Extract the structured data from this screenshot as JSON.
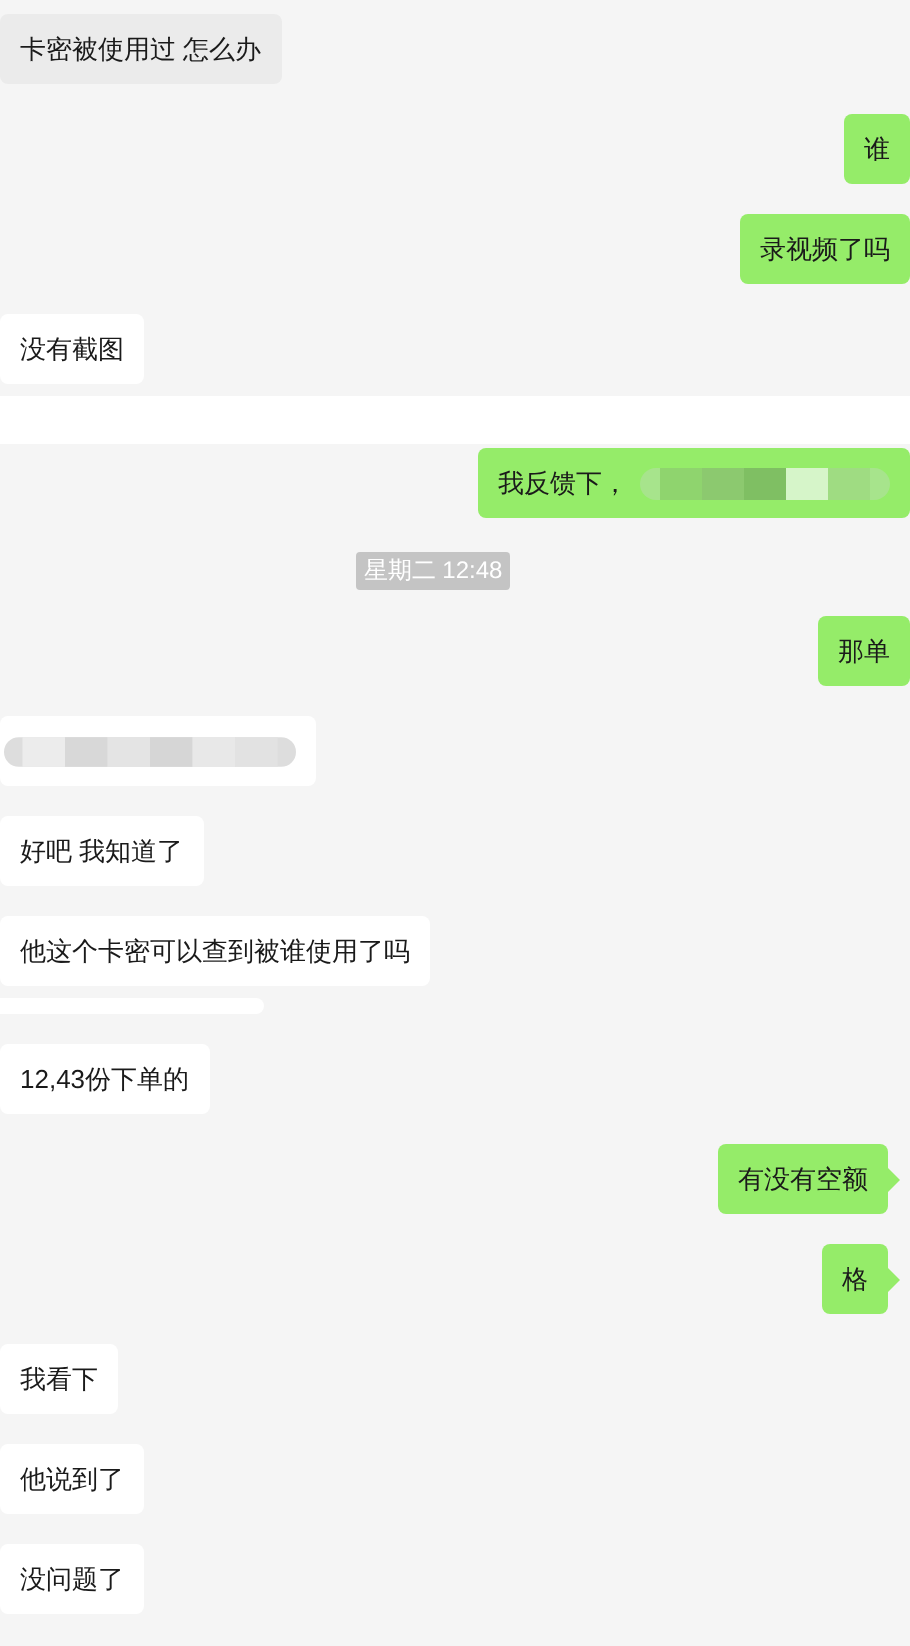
{
  "messages": [
    {
      "kind": "incoming",
      "text": "卡密被使用过 怎么办",
      "selected": true
    },
    {
      "kind": "outgoing",
      "text": "谁",
      "tail": false
    },
    {
      "kind": "outgoing",
      "text": "录视频了吗",
      "tail": false
    },
    {
      "kind": "incoming",
      "text": "没有截图",
      "selected": false
    },
    {
      "kind": "band"
    },
    {
      "kind": "outgoing",
      "text": "我反馈下，",
      "tail": false,
      "redacted": true
    },
    {
      "kind": "time",
      "text": "星期二 12:48"
    },
    {
      "kind": "outgoing",
      "text": "那单",
      "tail": false
    },
    {
      "kind": "blurred"
    },
    {
      "kind": "incoming",
      "text": "好吧 我知道了",
      "selected": false
    },
    {
      "kind": "incoming",
      "text": "他这个卡密可以查到被谁使用了吗",
      "selected": false
    },
    {
      "kind": "fragment"
    },
    {
      "kind": "incoming",
      "text": "12,43份下单的",
      "selected": false
    },
    {
      "kind": "outgoing",
      "text": "有没有空额",
      "tail": true
    },
    {
      "kind": "outgoing",
      "text": "格",
      "tail": true
    },
    {
      "kind": "incoming",
      "text": "我看下",
      "selected": false
    },
    {
      "kind": "incoming",
      "text": "他说到了",
      "selected": false
    },
    {
      "kind": "incoming",
      "text": "没问题了",
      "selected": false
    }
  ]
}
